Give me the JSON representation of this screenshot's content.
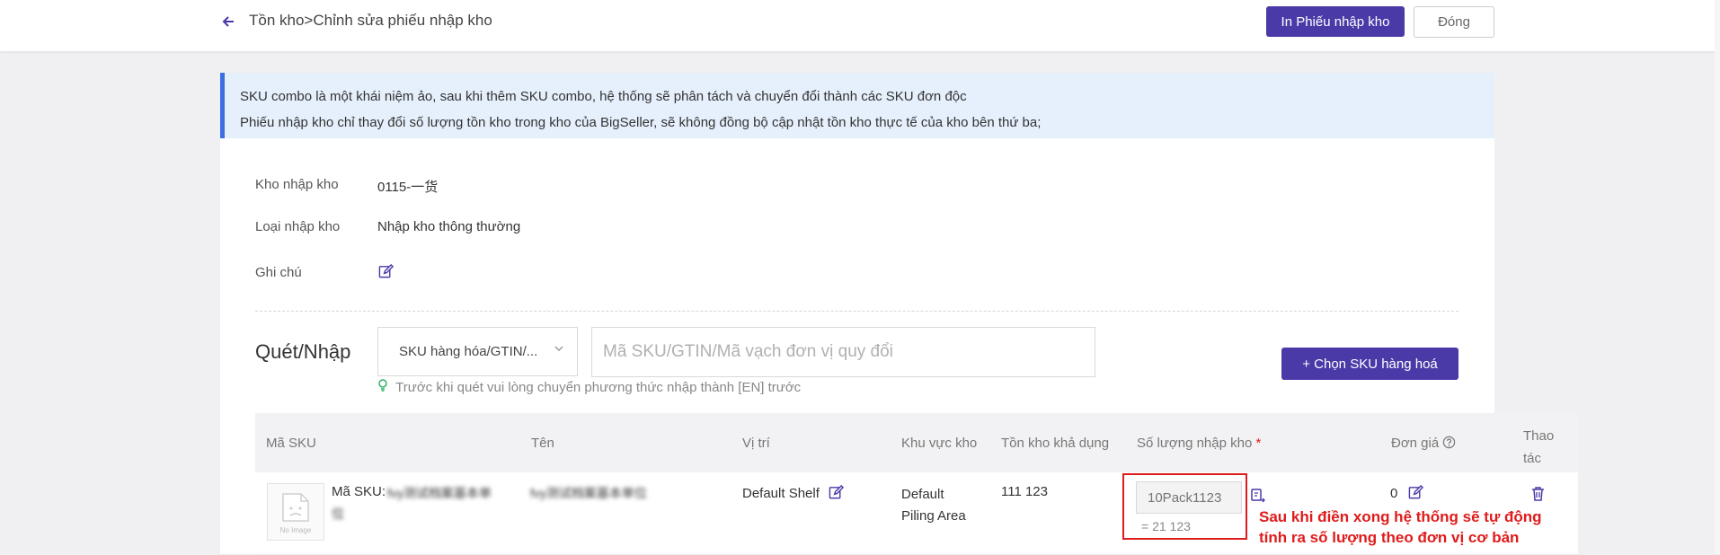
{
  "header": {
    "breadcrumb": "Tồn kho>Chỉnh sửa phiếu nhập kho",
    "print_button": "In Phiếu nhập kho",
    "close_button": "Đóng"
  },
  "notice": {
    "line1": "SKU combo là một khái niệm ảo, sau khi thêm SKU combo, hệ thống sẽ phân tách và chuyển đổi thành các SKU đơn độc",
    "line2": "Phiếu nhập kho chỉ thay đổi số lượng tồn kho trong kho của BigSeller, sẽ không đồng bộ cập nhật tồn kho thực tế của kho bên thứ ba;"
  },
  "form": {
    "warehouse_label": "Kho nhập kho",
    "warehouse_value": "0115-一货",
    "type_label": "Loại nhập kho",
    "type_value": "Nhập kho thông thường",
    "note_label": "Ghi chú"
  },
  "scan": {
    "label": "Quét/Nhập",
    "select_value": "SKU hàng hóa/GTIN/...",
    "input_placeholder": "Mã SKU/GTIN/Mã vạch đơn vị quy đổi",
    "hint": "Trước khi quét vui lòng chuyển phương thức nhập thành [EN] trước",
    "add_button": "+ Chọn SKU hàng hoá"
  },
  "table": {
    "columns": {
      "sku": "Mã SKU",
      "name": "Tên",
      "location": "Vị trí",
      "zone": "Khu vực kho",
      "available": "Tồn kho khả dụng",
      "quantity": "Số lượng nhập kho",
      "required_mark": "*",
      "price": "Đơn giá",
      "actions_line1": "Thao",
      "actions_line2": "tác"
    },
    "rows": [
      {
        "image_caption": "No Image",
        "sku_prefix": "Mã SKU:",
        "sku_blurred_1": "fvy测试档案基本单",
        "sku_blurred_2": "位",
        "name_blurred": "fvy测试档案基本单位",
        "location": "Default Shelf",
        "zone_line1": "Default",
        "zone_line2": "Piling Area",
        "available": "111 123",
        "quantity_placeholder": "10Pack1123",
        "quantity_converted": "= 21 123",
        "price": "0"
      }
    ]
  },
  "annotation": {
    "line1": "Sau khi điền xong hệ thống sẽ tự động",
    "line2": "tính ra số lượng theo đơn vị cơ bản"
  },
  "colors": {
    "primary": "#4a3aa8",
    "notice_bg": "#e6f0fc",
    "notice_border": "#3d6ee0",
    "annotation_red": "#e01b1b",
    "hint_icon": "#2fb46a"
  }
}
